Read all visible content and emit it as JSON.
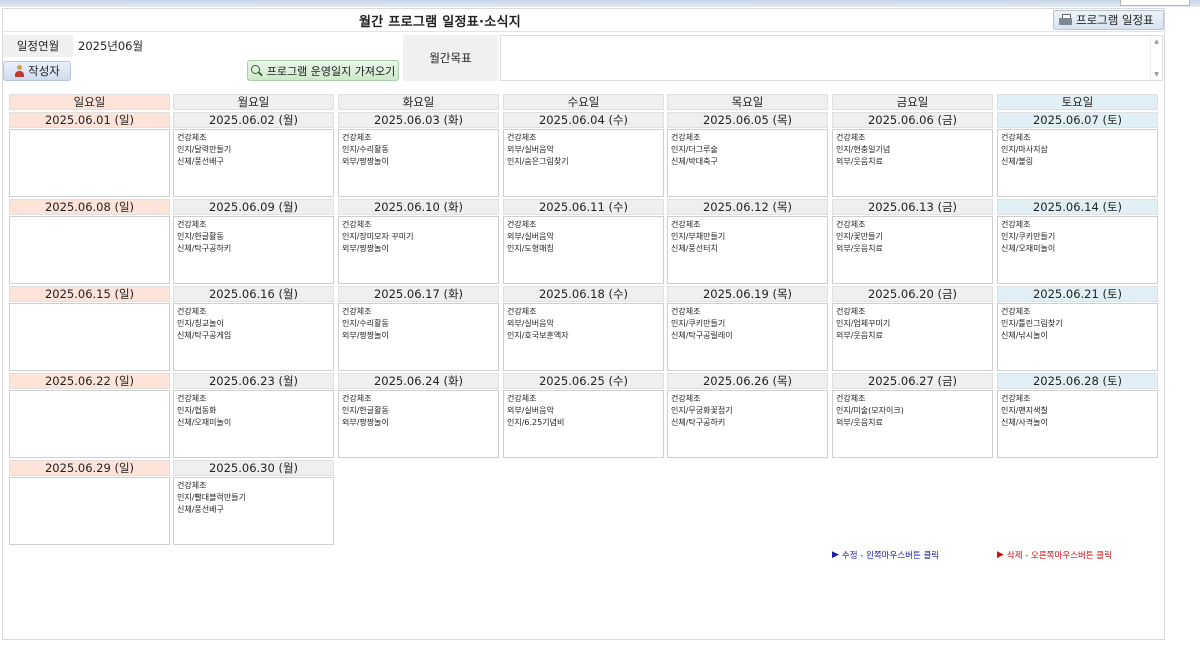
{
  "title": "월간 프로그램 일정표·소식지",
  "print_button": "프로그램 일정표",
  "form": {
    "month_label": "일정연월",
    "month_value": "2025년06월",
    "author_button": "작성자",
    "log_button": "프로그램 운영일지 가져오기",
    "goal_label": "월간목표",
    "goal_value": ""
  },
  "weekdays": [
    "일요일",
    "월요일",
    "화요일",
    "수요일",
    "목요일",
    "금요일",
    "토요일"
  ],
  "days": [
    {
      "date": "2025.06.01 (일)",
      "lines": []
    },
    {
      "date": "2025.06.02 (월)",
      "lines": [
        "건강체조",
        "인지/달력만들기",
        "신체/풍선배구"
      ]
    },
    {
      "date": "2025.06.03 (화)",
      "lines": [
        "건강체조",
        "인지/수리활동",
        "외부/짱짱놀이"
      ]
    },
    {
      "date": "2025.06.04 (수)",
      "lines": [
        "건강체조",
        "외부/실버음악",
        "인지/숨은그림찾기"
      ]
    },
    {
      "date": "2025.06.05 (목)",
      "lines": [
        "건강체조",
        "인지/더그루술",
        "신체/박대축구"
      ]
    },
    {
      "date": "2025.06.06 (금)",
      "lines": [
        "건강체조",
        "인지/현충일기념",
        "외부/웃음치료"
      ]
    },
    {
      "date": "2025.06.07 (토)",
      "lines": [
        "건강체조",
        "인지/마사지삼",
        "신체/볼링"
      ]
    },
    {
      "date": "2025.06.08 (일)",
      "lines": []
    },
    {
      "date": "2025.06.09 (월)",
      "lines": [
        "건강체조",
        "인지/한글활동",
        "신체/탁구공하키"
      ]
    },
    {
      "date": "2025.06.10 (화)",
      "lines": [
        "건강체조",
        "인지/장미모자 꾸미기",
        "외부/짱짱놀이"
      ]
    },
    {
      "date": "2025.06.11 (수)",
      "lines": [
        "건강체조",
        "외부/실버음악",
        "인지/도형매칭"
      ]
    },
    {
      "date": "2025.06.12 (목)",
      "lines": [
        "건강체조",
        "인지/부채만들기",
        "신체/풍선터치"
      ]
    },
    {
      "date": "2025.06.13 (금)",
      "lines": [
        "건강체조",
        "인지/꽃만들기",
        "외부/웃음치료"
      ]
    },
    {
      "date": "2025.06.14 (토)",
      "lines": [
        "건강체조",
        "인지/쿠키만들기",
        "신체/오재미놀이"
      ]
    },
    {
      "date": "2025.06.15 (일)",
      "lines": []
    },
    {
      "date": "2025.06.16 (월)",
      "lines": [
        "건강체조",
        "인지/칭교놀이",
        "신체/탁구공게임"
      ]
    },
    {
      "date": "2025.06.17 (화)",
      "lines": [
        "건강체조",
        "인지/수리활동",
        "외부/짱짱놀이"
      ]
    },
    {
      "date": "2025.06.18 (수)",
      "lines": [
        "건강체조",
        "외부/실버음악",
        "인지/호국보훈액자"
      ]
    },
    {
      "date": "2025.06.19 (목)",
      "lines": [
        "건강체조",
        "인지/쿠키만들기",
        "신체/탁구공릴레이"
      ]
    },
    {
      "date": "2025.06.20 (금)",
      "lines": [
        "건강체조",
        "인지/업체꾸미기",
        "외부/웃음치료"
      ]
    },
    {
      "date": "2025.06.21 (토)",
      "lines": [
        "건강체조",
        "인지/틀린그림찾기",
        "신체/낚시놀이"
      ]
    },
    {
      "date": "2025.06.22 (일)",
      "lines": []
    },
    {
      "date": "2025.06.23 (월)",
      "lines": [
        "건강체조",
        "인지/협동화",
        "신체/오재미놀이"
      ]
    },
    {
      "date": "2025.06.24 (화)",
      "lines": [
        "건강체조",
        "인지/한글활동",
        "외부/짱짱놀이"
      ]
    },
    {
      "date": "2025.06.25 (수)",
      "lines": [
        "건강체조",
        "외부/실버음악",
        "인지/6.25기념비"
      ]
    },
    {
      "date": "2025.06.26 (목)",
      "lines": [
        "건강체조",
        "인지/무궁화꽃접기",
        "신체/탁구공하키"
      ]
    },
    {
      "date": "2025.06.27 (금)",
      "lines": [
        "건강체조",
        "인지/미술(모자이크)",
        "외부/웃음치료"
      ]
    },
    {
      "date": "2025.06.28 (토)",
      "lines": [
        "건강체조",
        "인지/팬지색칠",
        "신체/사격놀이"
      ]
    },
    {
      "date": "2025.06.29 (일)",
      "lines": []
    },
    {
      "date": "2025.06.30 (월)",
      "lines": [
        "건강체조",
        "인지/빨대블럭만들기",
        "신체/풍선배구"
      ]
    }
  ],
  "legend": {
    "edit": "수정 - 왼쪽마우스버튼 클릭",
    "delete": "삭제 - 오른쪽마우스버튼 클릭",
    "edit_color": "#1a1aa6",
    "delete_color": "#d01010"
  },
  "colors": {
    "sunday_bg": "#fde3d8",
    "saturday_bg": "#e1f0f7",
    "weekday_bg": "#efefef"
  }
}
